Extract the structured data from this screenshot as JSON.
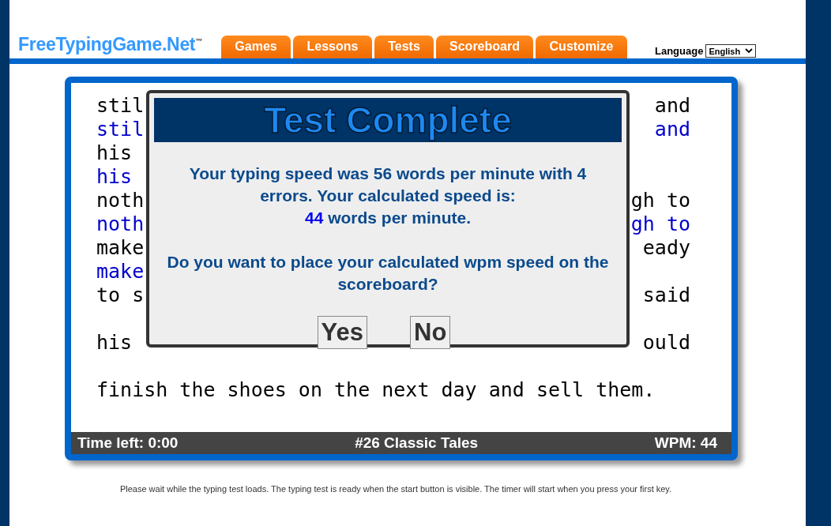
{
  "logo": {
    "name": "FreeTypingGame.Net",
    "mark": "™"
  },
  "tabs": [
    {
      "label": "Games",
      "selected": false
    },
    {
      "label": "Lessons",
      "selected": false
    },
    {
      "label": "Tests",
      "selected": false
    },
    {
      "label": "Scoreboard",
      "selected": false
    },
    {
      "label": "Customize",
      "selected": false
    }
  ],
  "language": {
    "label": "Language",
    "value": "English"
  },
  "text_lines": [
    {
      "kind": "source",
      "left": "stil",
      "right": "and"
    },
    {
      "kind": "typed",
      "left": "stil",
      "right": "and"
    },
    {
      "kind": "source",
      "left": "his"
    },
    {
      "kind": "typed",
      "left": "his"
    },
    {
      "kind": "source",
      "left": "noth",
      "right": "gh to"
    },
    {
      "kind": "typed",
      "left": "noth",
      "right": "gh to"
    },
    {
      "kind": "source",
      "left": "make",
      "right": "eady"
    },
    {
      "kind": "typed",
      "left": "make"
    },
    {
      "kind": "source",
      "left": "to s",
      "right": "said"
    },
    {
      "kind": "blank"
    },
    {
      "kind": "source",
      "left": "his",
      "right": "ould"
    },
    {
      "kind": "blank"
    },
    {
      "kind": "source",
      "left": "finish the shoes on the next day and sell them."
    }
  ],
  "status_bar": {
    "time_left": "Time left: 0:00",
    "test_name": "#26 Classic Tales",
    "wpm": "WPM: 44"
  },
  "dialog": {
    "title": "Test Complete",
    "message": "Your typing speed was 56 words per minute with 4 errors. Your calculated speed is:",
    "speed_value": "44",
    "speed_suffix": "words per minute.",
    "question": "Do you want to place your calculated wpm speed on the scoreboard?",
    "buttons": [
      "Yes",
      "No"
    ]
  },
  "footer_note": "Please wait while the typing test loads. The typing test is ready when the start button is visible. The timer will start when you press your first key."
}
